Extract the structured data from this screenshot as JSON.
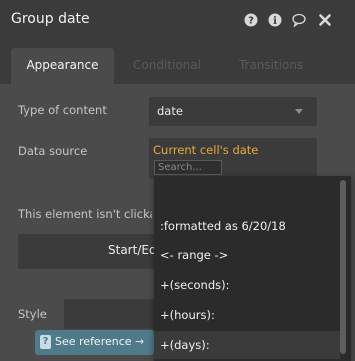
{
  "header": {
    "title": "Group date",
    "icons": [
      "help-icon",
      "info-icon",
      "comment-icon",
      "close-icon"
    ]
  },
  "tabs": [
    {
      "label": "Appearance",
      "active": true
    },
    {
      "label": "Conditional",
      "active": false
    },
    {
      "label": "Transitions",
      "active": false
    }
  ],
  "fields": {
    "type_label": "Type of content",
    "type_value": "date",
    "source_label": "Data source",
    "source_value": "Current cell's date",
    "search_placeholder": "Search...",
    "notice": "This element isn't clickable",
    "start_button": "Start/Edit workflow",
    "style_label": "Style"
  },
  "reference": {
    "label": "See reference →",
    "icon": "question-icon"
  },
  "dropdown": {
    "options": [
      ":formatted as 6/20/18",
      "<- range ->",
      "+(seconds):",
      "+(hours):",
      "+(days):"
    ],
    "highlighted_index": 4
  },
  "colors": {
    "accent_orange": "#e9a83c",
    "reference_blue": "#4e7a8a",
    "panel_bg": "#4b4b4b",
    "header_bg": "#3b3b3b"
  }
}
